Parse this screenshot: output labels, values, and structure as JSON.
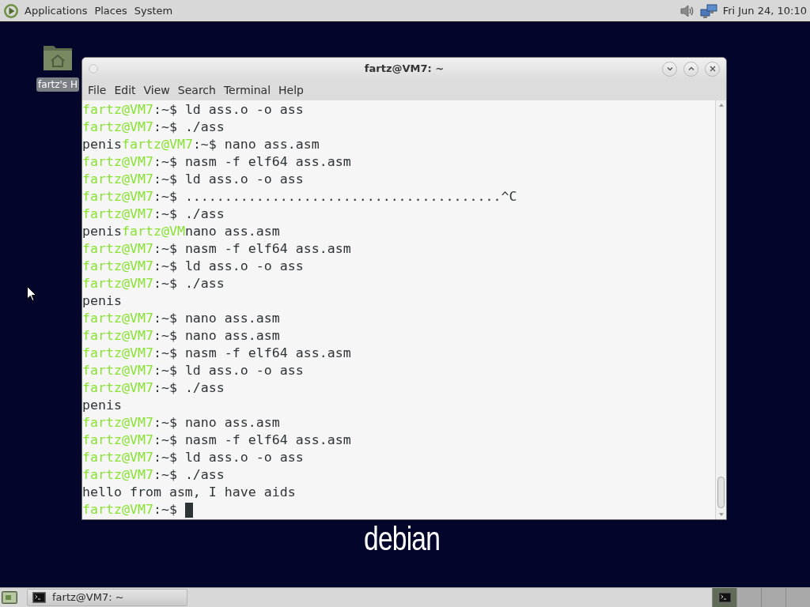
{
  "top_panel": {
    "menus": [
      "Applications",
      "Places",
      "System"
    ],
    "clock": "Fri Jun 24, 10:10"
  },
  "desktop_icons": [
    {
      "label": "fartz's H",
      "selected": true
    }
  ],
  "window": {
    "title": "fartz@VM7: ~",
    "menu": [
      "File",
      "Edit",
      "View",
      "Search",
      "Terminal",
      "Help"
    ],
    "lines": [
      [
        {
          "kind": "host",
          "text": "fartz@VM7"
        },
        {
          "kind": "plain",
          "text": ":~$ ld ass.o -o ass"
        }
      ],
      [
        {
          "kind": "host",
          "text": "fartz@VM7"
        },
        {
          "kind": "plain",
          "text": ":~$ ./ass"
        }
      ],
      [
        {
          "kind": "plain",
          "text": "penis"
        },
        {
          "kind": "host",
          "text": "fartz@VM7"
        },
        {
          "kind": "plain",
          "text": ":~$ nano ass.asm"
        }
      ],
      [
        {
          "kind": "host",
          "text": "fartz@VM7"
        },
        {
          "kind": "plain",
          "text": ":~$ nasm -f elf64 ass.asm"
        }
      ],
      [
        {
          "kind": "host",
          "text": "fartz@VM7"
        },
        {
          "kind": "plain",
          "text": ":~$ ld ass.o -o ass"
        }
      ],
      [
        {
          "kind": "host",
          "text": "fartz@VM7"
        },
        {
          "kind": "plain",
          "text": ":~$ ........................................^C"
        }
      ],
      [
        {
          "kind": "host",
          "text": "fartz@VM7"
        },
        {
          "kind": "plain",
          "text": ":~$ ./ass"
        }
      ],
      [
        {
          "kind": "plain",
          "text": "penis"
        },
        {
          "kind": "host",
          "text": "fartz@VM"
        },
        {
          "kind": "plain",
          "text": "nano ass.asm"
        }
      ],
      [
        {
          "kind": "host",
          "text": "fartz@VM7"
        },
        {
          "kind": "plain",
          "text": ":~$ nasm -f elf64 ass.asm"
        }
      ],
      [
        {
          "kind": "host",
          "text": "fartz@VM7"
        },
        {
          "kind": "plain",
          "text": ":~$ ld ass.o -o ass"
        }
      ],
      [
        {
          "kind": "host",
          "text": "fartz@VM7"
        },
        {
          "kind": "plain",
          "text": ":~$ ./ass"
        }
      ],
      [
        {
          "kind": "plain",
          "text": "penis"
        }
      ],
      [
        {
          "kind": "host",
          "text": "fartz@VM7"
        },
        {
          "kind": "plain",
          "text": ":~$ nano ass.asm"
        }
      ],
      [
        {
          "kind": "host",
          "text": "fartz@VM7"
        },
        {
          "kind": "plain",
          "text": ":~$ nano ass.asm"
        }
      ],
      [
        {
          "kind": "host",
          "text": "fartz@VM7"
        },
        {
          "kind": "plain",
          "text": ":~$ nasm -f elf64 ass.asm"
        }
      ],
      [
        {
          "kind": "host",
          "text": "fartz@VM7"
        },
        {
          "kind": "plain",
          "text": ":~$ ld ass.o -o ass"
        }
      ],
      [
        {
          "kind": "host",
          "text": "fartz@VM7"
        },
        {
          "kind": "plain",
          "text": ":~$ ./ass"
        }
      ],
      [
        {
          "kind": "plain",
          "text": "penis"
        }
      ],
      [
        {
          "kind": "host",
          "text": "fartz@VM7"
        },
        {
          "kind": "plain",
          "text": ":~$ nano ass.asm"
        }
      ],
      [
        {
          "kind": "host",
          "text": "fartz@VM7"
        },
        {
          "kind": "plain",
          "text": ":~$ nasm -f elf64 ass.asm"
        }
      ],
      [
        {
          "kind": "host",
          "text": "fartz@VM7"
        },
        {
          "kind": "plain",
          "text": ":~$ ld ass.o -o ass"
        }
      ],
      [
        {
          "kind": "host",
          "text": "fartz@VM7"
        },
        {
          "kind": "plain",
          "text": ":~$ ./ass"
        }
      ],
      [
        {
          "kind": "plain",
          "text": "hello from asm, I have aids"
        }
      ],
      [
        {
          "kind": "host",
          "text": "fartz@VM7"
        },
        {
          "kind": "plain",
          "text": ":~$"
        }
      ]
    ],
    "cursor": true
  },
  "wallpaper": {
    "logo": "debian"
  },
  "taskbar": {
    "tasks": [
      {
        "label": "fartz@VM7: ~"
      }
    ],
    "workspaces": [
      {
        "selected": true,
        "has_window": true
      },
      {
        "selected": false,
        "has_window": false
      },
      {
        "selected": false,
        "has_window": false
      },
      {
        "selected": false,
        "has_window": false
      }
    ]
  }
}
